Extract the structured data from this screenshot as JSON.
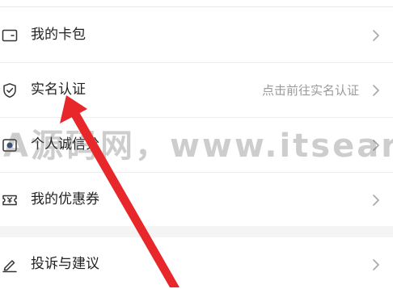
{
  "menu": {
    "items": [
      {
        "label": "我的卡包",
        "icon": "wallet-card-icon"
      },
      {
        "label": "实名认证",
        "icon": "shield-check-icon",
        "hint": "点击前往实名认证"
      },
      {
        "label": "个人诚信分",
        "icon": "badge-icon"
      },
      {
        "label": "我的优惠券",
        "icon": "coupon-icon"
      },
      {
        "label": "投诉与建议",
        "icon": "pencil-edit-icon"
      }
    ]
  },
  "overlay": {
    "watermark": "A源码网，www.itsear.co",
    "arrow_color": "#e8272b"
  },
  "colors": {
    "text": "#222222",
    "hint": "#9a9a9a",
    "chevron": "#a8a8a8",
    "divider": "#eeeeee",
    "section_gap": "#f4f4f4"
  }
}
